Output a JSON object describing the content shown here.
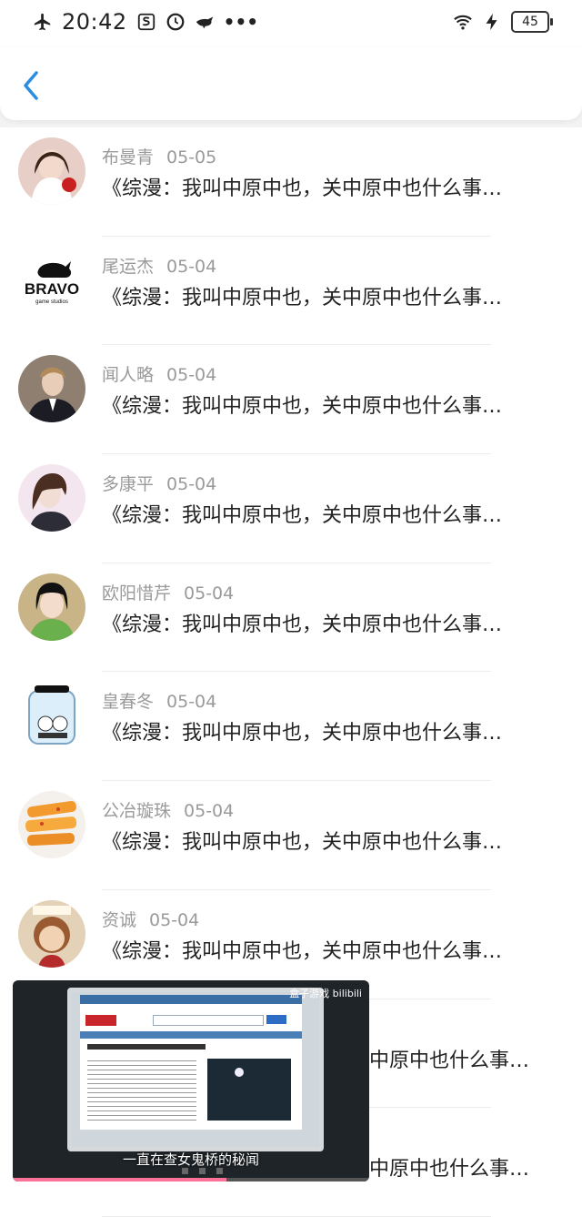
{
  "status_bar": {
    "time": "20:42",
    "battery": "45"
  },
  "contacts": [
    {
      "name": "布曼青",
      "date": "05-05",
      "message": "《综漫：我叫中原中也，关中原中也什么事…"
    },
    {
      "name": "尾运杰",
      "date": "05-04",
      "message": "《综漫：我叫中原中也，关中原中也什么事…"
    },
    {
      "name": "闻人略",
      "date": "05-04",
      "message": "《综漫：我叫中原中也，关中原中也什么事…"
    },
    {
      "name": "多康平",
      "date": "05-04",
      "message": "《综漫：我叫中原中也，关中原中也什么事…"
    },
    {
      "name": "欧阳惜芹",
      "date": "05-04",
      "message": "《综漫：我叫中原中也，关中原中也什么事…"
    },
    {
      "name": "皇春冬",
      "date": "05-04",
      "message": "《综漫：我叫中原中也，关中原中也什么事…"
    },
    {
      "name": "公冶璇珠",
      "date": "05-04",
      "message": "《综漫：我叫中原中也，关中原中也什么事…"
    },
    {
      "name": "资诚",
      "date": "05-04",
      "message": "《综漫：我叫中原中也，关中原中也什么事…"
    },
    {
      "name": "",
      "date": "",
      "message": "中原中也什么事…"
    },
    {
      "name": "",
      "date": "",
      "message": "中原中也什么事…"
    }
  ],
  "video_overlay": {
    "caption": "一直在查女鬼桥的秘闻",
    "brand": "盒子游戏 bilibili",
    "progress": 0.6
  },
  "avatar_colors": [
    "#e8c0c0",
    "#ffffff",
    "#8c7c6c",
    "#f2e3e8",
    "#c8b68a",
    "#e8f2fa",
    "#f5a040",
    "#c59a74",
    "#999999",
    "#999999"
  ]
}
